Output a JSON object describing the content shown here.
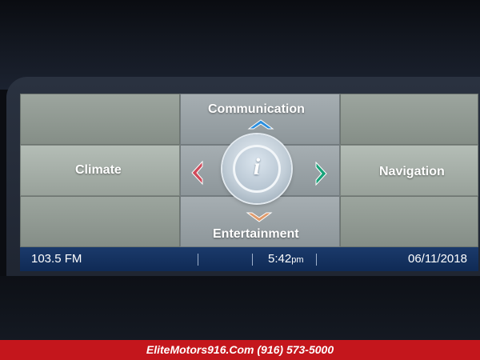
{
  "menu": {
    "top_label": "Communication",
    "left_label": "Climate",
    "right_label": "Navigation",
    "bottom_label": "Entertainment",
    "center_glyph": "i",
    "up_arrow_color": "#2a8fe0",
    "left_arrow_color": "#d04a5a",
    "right_arrow_color": "#19a37a",
    "down_arrow_color": "#e09a6a"
  },
  "status": {
    "radio": "103.5 FM",
    "time": "5:42",
    "time_suffix": "pm",
    "date": "06/11/2018"
  },
  "banner": {
    "text": "EliteMotors916.Com (916) 573-5000"
  }
}
